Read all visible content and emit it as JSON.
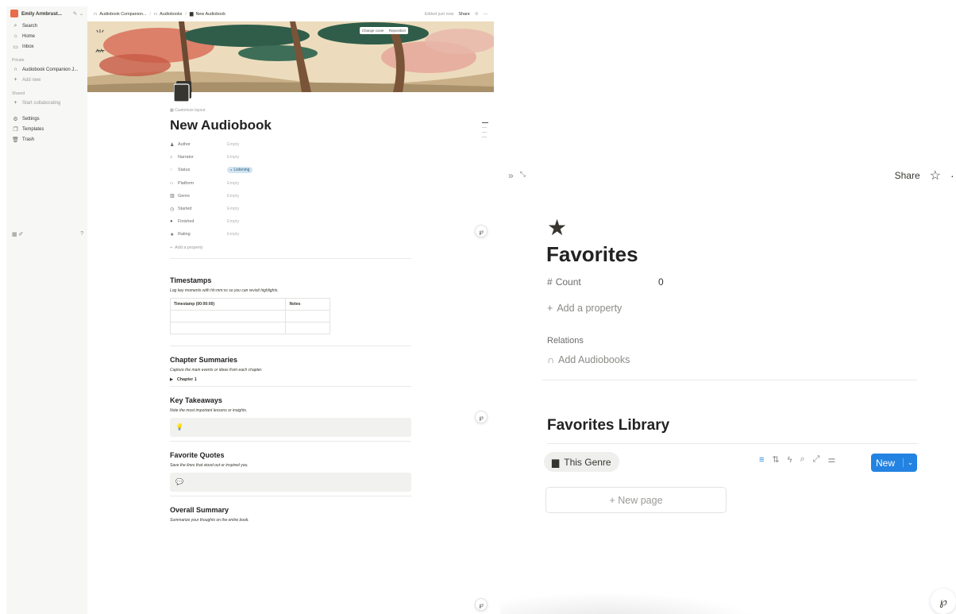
{
  "sidebar": {
    "workspace_name": "Emily Armbrust...",
    "items": [
      {
        "label": "Search",
        "icon": "search-icon"
      },
      {
        "label": "Home",
        "icon": "home-icon"
      },
      {
        "label": "Inbox",
        "icon": "inbox-icon"
      }
    ],
    "private_label": "Private",
    "private_items": [
      {
        "label": "Audiobook Companion J...",
        "icon": "headphones-icon"
      },
      {
        "label": "Add new",
        "icon": "plus-icon"
      }
    ],
    "shared_label": "Shared",
    "shared_items": [
      {
        "label": "Start collaborating",
        "icon": "plus-icon"
      }
    ],
    "footer_items": [
      {
        "label": "Settings",
        "icon": "gear-icon"
      },
      {
        "label": "Templates",
        "icon": "templates-icon"
      },
      {
        "label": "Trash",
        "icon": "trash-icon"
      }
    ]
  },
  "topbar": {
    "breadcrumbs": [
      "Audiobook Companion...",
      "Audiobooks",
      "New Audiobook"
    ],
    "edited": "Edited just now",
    "share": "Share"
  },
  "cover": {
    "change_cover": "Change cover",
    "reposition": "Reposition"
  },
  "page": {
    "customize": "Customize layout",
    "title": "New Audiobook",
    "properties": [
      {
        "name": "Author",
        "value": "Empty",
        "icon": "person-icon"
      },
      {
        "name": "Narrator",
        "value": "Empty",
        "icon": "mic-icon"
      },
      {
        "name": "Status",
        "value": "Listening",
        "icon": "status-icon",
        "tag": true
      },
      {
        "name": "Platform",
        "value": "Empty",
        "icon": "headphones-icon"
      },
      {
        "name": "Genre",
        "value": "Empty",
        "icon": "books-icon"
      },
      {
        "name": "Started",
        "value": "Empty",
        "icon": "clock-icon"
      },
      {
        "name": "Finished",
        "value": "Empty",
        "icon": "check-circle-icon"
      },
      {
        "name": "Rating",
        "value": "Empty",
        "icon": "star-icon"
      }
    ],
    "add_property": "Add a property",
    "sections": {
      "timestamps": {
        "title": "Timestamps",
        "desc": "Log key moments with hh:mm:ss so you can revisit highlights.",
        "col1": "Timestamp (00:00:00)",
        "col2": "Notes"
      },
      "chapters": {
        "title": "Chapter Summaries",
        "desc": "Capture the main events or ideas from each chapter.",
        "toggle": "Chapter 1"
      },
      "takeaways": {
        "title": "Key Takeaways",
        "desc": "Note the most important lessons or insights."
      },
      "quotes": {
        "title": "Favorite Quotes",
        "desc": "Save the lines that stood out or inspired you."
      },
      "summary": {
        "title": "Overall Summary",
        "desc": "Summarize your thoughts on the entire book."
      }
    }
  },
  "right_panel": {
    "share": "Share",
    "title": "Favorites",
    "count_label": "Count",
    "count_value": "0",
    "add_property": "Add a property",
    "relations_label": "Relations",
    "add_relation": "Add Audiobooks",
    "library_title": "Favorites Library",
    "view_tab": "This Genre",
    "new_button": "New",
    "new_page": "+ New page",
    "accent_color": "#2383e2"
  }
}
